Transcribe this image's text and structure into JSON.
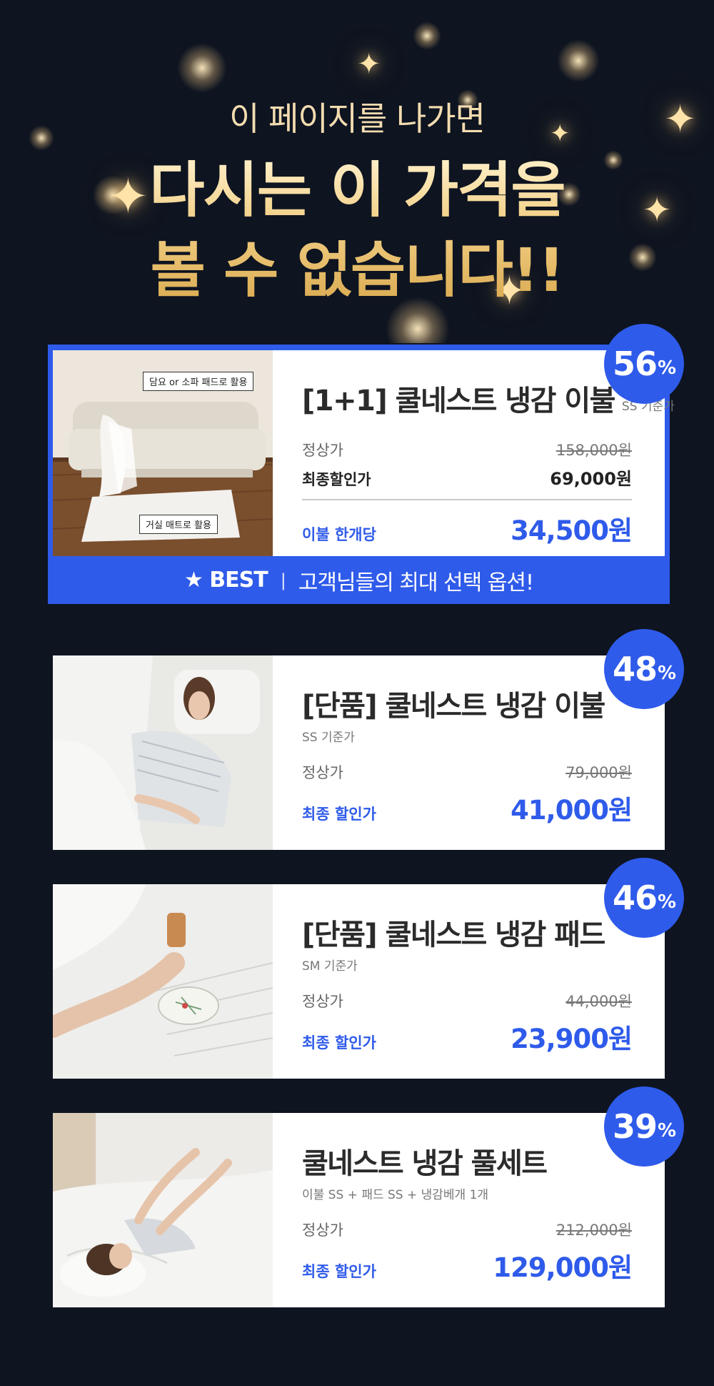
{
  "hero": {
    "subtitle": "이 페이지를 나가면",
    "title_line1": "다시는 이 가격을",
    "title_line2": "볼 수 없습니다!!"
  },
  "colors": {
    "background": "#0e1420",
    "accent_blue": "#2f5bea",
    "gold": "#f2cf86"
  },
  "products": [
    {
      "badge": "56",
      "badge_unit": "%",
      "name": "[1+1] 쿨네스트 냉감 이불",
      "basis": "SS 기준가",
      "regular_label": "정상가",
      "regular_price": "158,000원",
      "final_label": "최종할인가",
      "final_price": "69,000원",
      "unit_label": "이불 한개당",
      "unit_price": "34,500원",
      "callout_top": "담요 or 소파 패드로 활용",
      "callout_bottom": "거실 매트로 활용",
      "best_tag": "★ BEST",
      "best_sep": "|",
      "best_text": "고객님들의 최대 선택 옵션!"
    },
    {
      "badge": "48",
      "badge_unit": "%",
      "name": "[단품] 쿨네스트 냉감 이불",
      "basis": "SS 기준가",
      "regular_label": "정상가",
      "regular_price": "79,000원",
      "final_label": "최종 할인가",
      "final_price": "41,000원"
    },
    {
      "badge": "46",
      "badge_unit": "%",
      "name": "[단품] 쿨네스트 냉감 패드",
      "basis": "SM 기준가",
      "regular_label": "정상가",
      "regular_price": "44,000원",
      "final_label": "최종 할인가",
      "final_price": "23,900원"
    },
    {
      "badge": "39",
      "badge_unit": "%",
      "name": "쿨네스트 냉감 풀세트",
      "basis": "이불 SS + 패드 SS + 냉감베개 1개",
      "regular_label": "정상가",
      "regular_price": "212,000원",
      "final_label": "최종 할인가",
      "final_price": "129,000원"
    }
  ]
}
